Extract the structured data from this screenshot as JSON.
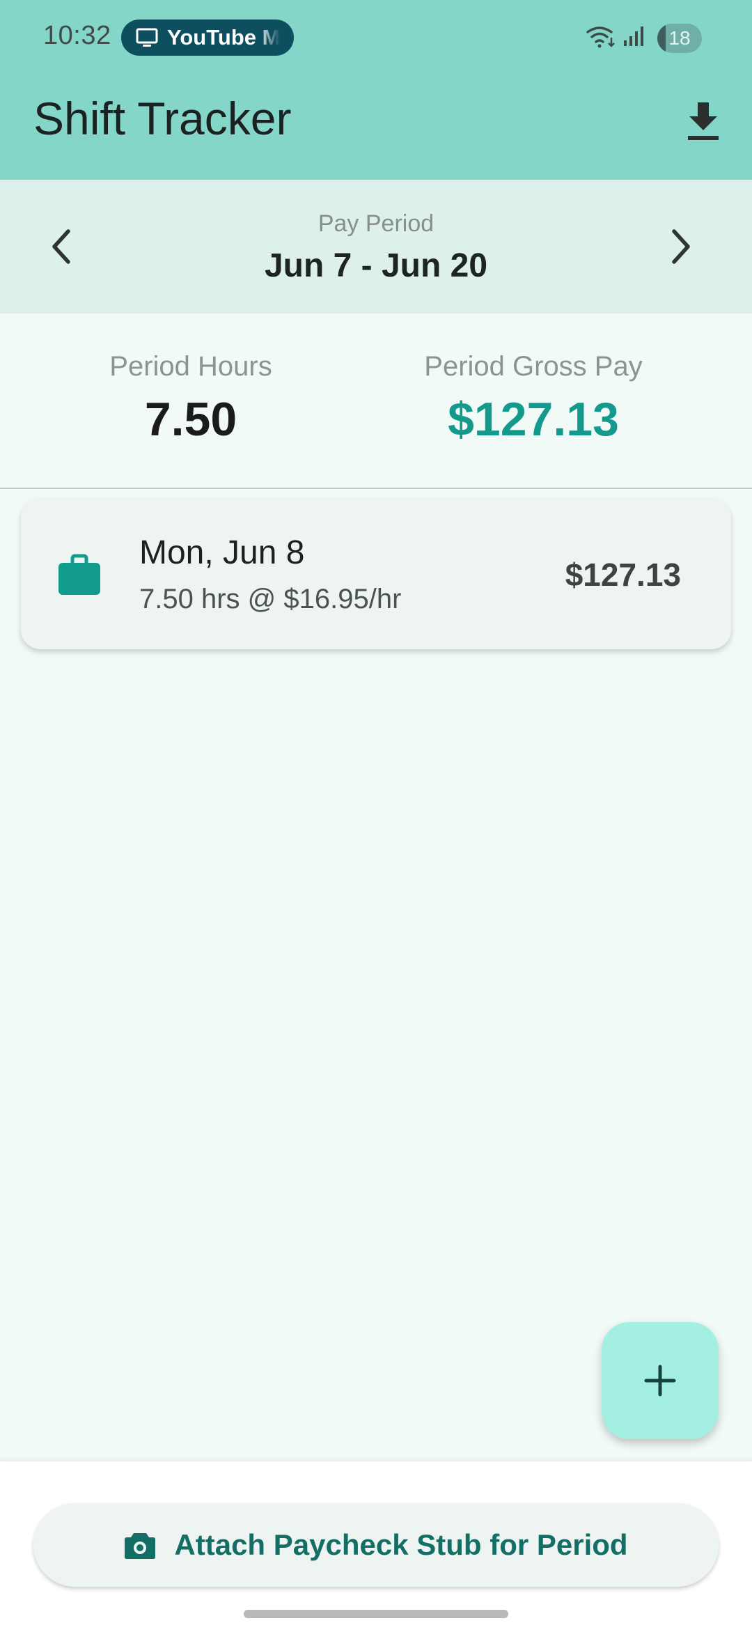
{
  "status_bar": {
    "time": "10:32",
    "cast_chip": "YouTube M",
    "battery": "18",
    "battery_level": 0.18,
    "icons": [
      "tv-icon",
      "wifi-icon",
      "cell-signal-icon",
      "battery-icon"
    ]
  },
  "app_bar": {
    "title": "Shift Tracker",
    "action_icon": "download-icon"
  },
  "pay_period": {
    "label": "Pay Period",
    "range": "Jun 7 - Jun 20",
    "prev_icon": "chevron-left-icon",
    "next_icon": "chevron-right-icon"
  },
  "summary": {
    "hours_label": "Period Hours",
    "hours_value": "7.50",
    "pay_label": "Period Gross Pay",
    "pay_value": "$127.13"
  },
  "shifts": [
    {
      "date": "Mon, Jun 8",
      "detail": "7.50 hrs @ $16.95/hr",
      "amount": "$127.13",
      "icon": "briefcase-icon"
    }
  ],
  "fab": {
    "icon": "plus-icon"
  },
  "attach": {
    "label": "Attach Paycheck Stub for Period",
    "icon": "camera-icon"
  },
  "colors": {
    "app_bar": "#84D6C9",
    "period_nav": "#DDF0EC",
    "accent": "#149A8D",
    "fab": "#A3EFE1",
    "button_text": "#136F66"
  }
}
